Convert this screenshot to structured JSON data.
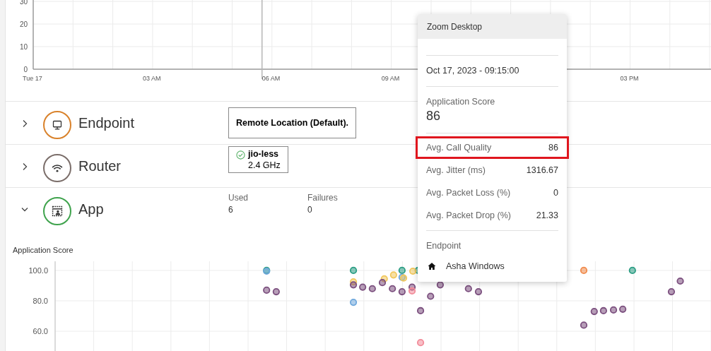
{
  "top_chart": {
    "y_labels": [
      "30",
      "20",
      "10",
      "0"
    ],
    "x_labels": [
      "Tue 17",
      "03 AM",
      "06 AM",
      "09 AM",
      "03 PM"
    ]
  },
  "sections": [
    {
      "kind": "endpoint",
      "name": "Endpoint",
      "expanded": false,
      "color": "#d9822b",
      "location": "Remote Location (Default)."
    },
    {
      "kind": "router",
      "name": "Router",
      "expanded": false,
      "color": "#7b6e6a",
      "network": {
        "connected": true,
        "ssid": "jio-less",
        "band": "2.4 GHz"
      }
    },
    {
      "kind": "app",
      "name": "App",
      "expanded": true,
      "color": "#3fa34d",
      "stats": [
        {
          "label": "Used",
          "value": "6"
        },
        {
          "label": "Failures",
          "value": "0"
        }
      ]
    }
  ],
  "score_chart": {
    "title": "Application Score",
    "y_labels": [
      "100.0",
      "80.0",
      "60.0"
    ]
  },
  "tooltip": {
    "title": "Zoom Desktop",
    "timestamp": "Oct 17, 2023 - 09:15:00",
    "score_label": "Application Score",
    "score": "86",
    "metrics": [
      {
        "label": "Avg. Call Quality",
        "value": "86",
        "highlighted": true
      },
      {
        "label": "Avg. Jitter (ms)",
        "value": "1316.67",
        "highlighted": false
      },
      {
        "label": "Avg. Packet Loss (%)",
        "value": "0",
        "highlighted": false
      },
      {
        "label": "Avg. Packet Drop (%)",
        "value": "21.33",
        "highlighted": false
      }
    ],
    "endpoint_label": "Endpoint",
    "endpoint_name": "Asha Windows"
  }
}
